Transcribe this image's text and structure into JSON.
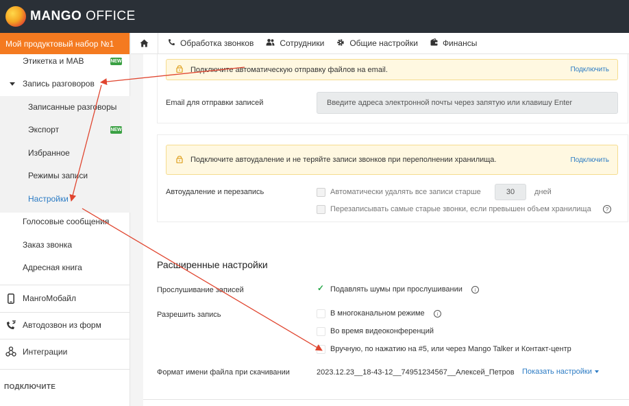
{
  "brand": {
    "logo_bold": "MANGO",
    "logo_light": " OFFICE"
  },
  "sidebar": {
    "product_set": "Мой продуктовый набор №1",
    "items": [
      {
        "label": "Этикетка и МАВ",
        "badge": "NEW"
      },
      {
        "label": "Запись разговоров"
      },
      {
        "label": "Записанные разговоры"
      },
      {
        "label": "Экспорт",
        "badge": "NEW"
      },
      {
        "label": "Избранное"
      },
      {
        "label": "Режимы записи"
      },
      {
        "label": "Настройки"
      },
      {
        "label": "Голосовые сообщения"
      },
      {
        "label": "Заказ звонка"
      },
      {
        "label": "Адресная книга"
      },
      {
        "label": "МангоМобайл"
      },
      {
        "label": "Автодозвон из форм"
      },
      {
        "label": "Интеграции"
      }
    ],
    "connect_title": "ПОДКЛЮЧИТЕ"
  },
  "nav": {
    "items": [
      {
        "label": "Обработка звонков",
        "icon": "phone-icon"
      },
      {
        "label": "Сотрудники",
        "icon": "users-icon"
      },
      {
        "label": "Общие настройки",
        "icon": "gear-icon"
      },
      {
        "label": "Финансы",
        "icon": "wallet-icon"
      }
    ]
  },
  "email_section": {
    "warning": "Подключите автоматическую отправку файлов на email.",
    "connect": "Подключить",
    "label": "Email для отправки записей",
    "placeholder": "Введите адреса электронной почты через запятую или клавишу Enter"
  },
  "autodelete_section": {
    "warning": "Подключите автоудаление и не теряйте записи звонков при переполнении хранилища.",
    "connect": "Подключить",
    "label": "Автоудаление и перезапись",
    "option1_prefix": "Автоматически удалять все записи старше",
    "days_value": "30",
    "days_unit": "дней",
    "option2": "Перезаписывать самые старые звонки, если превышен объем хранилища"
  },
  "advanced": {
    "title": "Расширенные настройки",
    "listening_label": "Прослушивание записей",
    "noise_option": "Подавлять шумы при прослушивании",
    "allow_label": "Разрешить запись",
    "allow_options": [
      "В многоканальном режиме",
      "Во время видеоконференций",
      "Вручную, по нажатию на #5, или через Mango Talker и Контакт-центр"
    ],
    "filename_label": "Формат имени файла при скачивании",
    "filename_value": "2023.12.23__18-43-12__74951234567__Алексей_Петров",
    "show_settings": "Показать настройки"
  },
  "colors": {
    "accent_orange": "#f47a20",
    "topbar": "#2a3037",
    "link": "#2b7bc4",
    "arrow": "#e0452f",
    "check_green": "#27a84a"
  }
}
